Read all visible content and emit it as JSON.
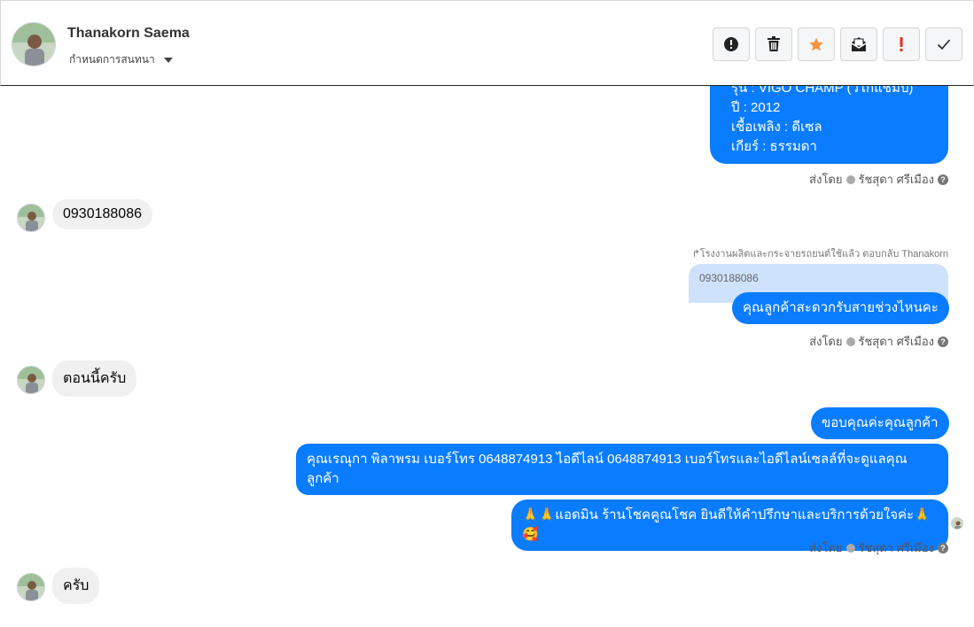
{
  "header": {
    "contact_name": "Thanakorn Saema",
    "assign_label": "กำหนดการสนทนา",
    "toolbar": [
      {
        "name": "report-button",
        "icon": "alert-circle-icon"
      },
      {
        "name": "delete-button",
        "icon": "trash-icon"
      },
      {
        "name": "star-button",
        "icon": "star-icon",
        "color": "#f7923b"
      },
      {
        "name": "mark-unread-button",
        "icon": "envelope-open-icon"
      },
      {
        "name": "mark-important-button",
        "icon": "exclamation-icon",
        "color": "#e0302a"
      },
      {
        "name": "mark-done-button",
        "icon": "check-icon"
      }
    ]
  },
  "messages": {
    "m1_lines": [
      "รุ่น : VIGO CHAMP (วีโก้แชมป์)",
      "ปี : 2012",
      "เชื้อเพลิง : ดีเซล",
      "เกียร์ : ธรรมดา"
    ],
    "sent_by_prefix": "ส่งโดย",
    "sent_by_name": "รัชสุดา ศรีเมือง",
    "in_phone": "0930188086",
    "reply_note": "โรงงานผลิตและกระจายรถยนต์ใช้แล้ว ตอบกลับ Thanakorn",
    "quoted_text": "0930188086",
    "out_ask_time": "คุณลูกค้าสะดวกรับสายช่วงไหนคะ",
    "in_now": "ตอนนี้ครับ",
    "out_thanks": "ขอบคุณค่ะคุณลูกค้า",
    "out_contact": "คุณเรณุกา พิลาพรม        เบอร์โทร 0648874913  ไอดีไลน์ 0648874913   เบอร์โทรและไอดีไลน์เซลล์ที่จะดูแลคุณลูกค้า",
    "out_admin": "🙏🙏แอดมิน ร้านโชคคูณโชค ยินดีให้คำปรึกษาและบริการด้วยใจค่ะ🙏🥰",
    "in_ok": "ครับ"
  },
  "colors": {
    "accent": "#0a7cff",
    "incoming": "#f0f0f0",
    "quoted": "#cfe2fd"
  }
}
